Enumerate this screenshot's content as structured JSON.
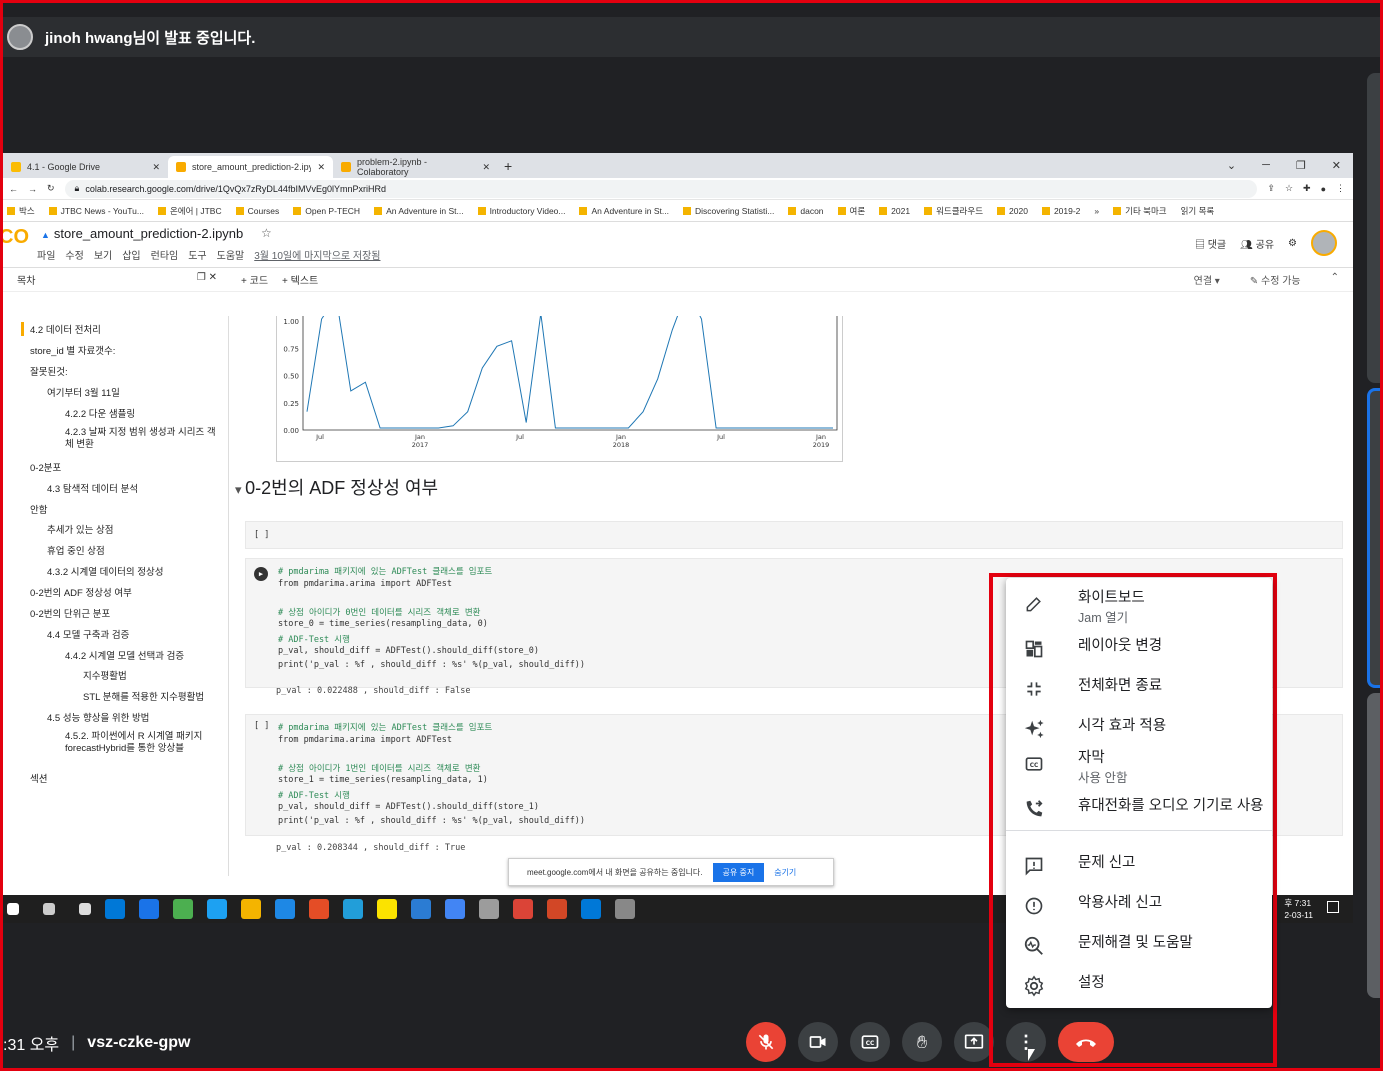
{
  "presenter": {
    "text": "jinoh hwang님이 발표 중입니다."
  },
  "browser": {
    "tabs": [
      {
        "label": "4.1 - Google Drive",
        "favicon_color": "#fbbc04"
      },
      {
        "label": "store_amount_prediction-2.ipyn",
        "favicon_color": "#f9ab00"
      },
      {
        "label": "problem-2.ipynb - Colaboratory",
        "favicon_color": "#f9ab00"
      }
    ],
    "new_tab": "+",
    "url": "colab.research.google.com/drive/1QvQx7zRyDL44fbIMVvEg0lYmnPxriHRd",
    "bookmarks": [
      "박스",
      "JTBC News - YouTu...",
      "온에어 | JTBC",
      "Courses",
      "Open P-TECH",
      "An Adventure in St...",
      "Introductory Video...",
      "An Adventure in St...",
      "Discovering Statisti...",
      "dacon",
      "여론",
      "2021",
      "워드클라우드",
      "2020",
      "2019-2"
    ],
    "bookmarks_more": "»",
    "bookmarks_other": "기타 북마크",
    "reading_list": "읽기 목록"
  },
  "colab": {
    "title": "store_amount_prediction-2.ipynb",
    "menus": [
      "파일",
      "수정",
      "보기",
      "삽입",
      "런타임",
      "도구",
      "도움말"
    ],
    "saved_text": "3월 10일에 마지막으로 저장됨",
    "comment_label": "댓글",
    "share_label": "공유",
    "toc_label": "목차",
    "add_code": "+ 코드",
    "add_text": "+ 텍스트",
    "connect": "연결",
    "editable": "수정 가능",
    "toc": [
      "4.2 데이터 전처리",
      "store_id 별 자료갯수:",
      "잘못된것:",
      "여기부터 3월 11일",
      "4.2.2 다운 샘플링",
      "4.2.3 날짜 지정 범위 생성과 시리즈 객체 변환",
      "0-2분포",
      "4.3 탐색적 데이터 분석",
      "안함",
      "추세가 있는 상점",
      "휴업 중인 상점",
      "4.3.2 시계열 데이터의 정상성",
      "0-2번의 ADF 정상성 여부",
      "0-2번의 단위근 분포",
      "4.4 모델 구축과 검증",
      "4.4.2 시계열 모델 선택과 검증",
      "지수평활법",
      "STL 분해를 적용한 지수평활법",
      "4.5 성능 향상을 위한 방법",
      "4.5.2. 파이썬에서 R 시계열 패키지 forecastHybrid를 통한 앙상블",
      "섹션"
    ],
    "section_heading": "0-2번의 ADF 정상성 여부",
    "empty_cell": "[ ]",
    "cell1": [
      "# pmdarima 패키지에 있는 ADFTest 클래스를 임포트",
      "from pmdarima.arima import ADFTest",
      "",
      "# 상점 아이디가 0번인 데이터를 시리즈 객체로 변환",
      "store_0 = time_series(resampling_data, 0)",
      "# ADF-Test 시행",
      "p_val, should_diff = ADFTest().should_diff(store_0)",
      "print('p_val : %f , should_diff : %s' %(p_val, should_diff))"
    ],
    "cell1_output": "p_val : 0.022488 , should_diff : False",
    "cell2": [
      "# pmdarima 패키지에 있는 ADFTest 클래스를 임포트",
      "from pmdarima.arima import ADFTest",
      "",
      "# 상점 아이디가 1번인 데이터를 시리즈 객체로 변환",
      "store_1 = time_series(resampling_data, 1)",
      "# ADF-Test 시행",
      "p_val, should_diff = ADFTest().should_diff(store_1)",
      "print('p_val : %f , should_diff : %s' %(p_val, should_diff))"
    ],
    "cell2_output": "p_val : 0.208344 , should_diff : True"
  },
  "chart_data": {
    "type": "line",
    "y_ticks": [
      "1.00",
      "0.75",
      "0.50",
      "0.25",
      "0.00"
    ],
    "ylim": [
      0,
      1
    ],
    "x_ticks": [
      "Jul",
      "Jan\n2017",
      "Jul",
      "Jan\n2018",
      "Jul",
      "Jan\n2019"
    ],
    "series": [
      {
        "values": [
          0.15,
          1.0,
          1.2,
          0.34,
          0.42,
          0.0,
          0.0,
          0.0,
          0.0,
          0.0,
          0.02,
          0.15,
          0.55,
          0.75,
          0.8,
          0.05,
          1.05,
          0.0,
          0.0,
          0.0,
          0.0,
          0.0,
          0.0,
          0.15,
          0.45,
          0.9,
          1.35,
          1.0,
          0.0,
          0.0,
          0.0,
          0.0,
          0.0,
          0.0,
          0.0,
          0.0,
          0.0
        ]
      }
    ],
    "color": "#1f77b4"
  },
  "share_notice": {
    "text": "meet.google.com에서 내 화면을 공유하는 중입니다.",
    "stop": "공유 중지",
    "hide": "숨기기"
  },
  "taskbar": {
    "time": "후 7:31",
    "date": "2-03-11"
  },
  "meeting": {
    "time": ":31 오후",
    "separator": "|",
    "code": "vsz-czke-gpw"
  },
  "menu": {
    "items": [
      {
        "label": "화이트보드",
        "sub": "Jam 열기",
        "icon": "pencil-icon"
      },
      {
        "label": "레이아웃 변경",
        "icon": "layout-icon"
      },
      {
        "label": "전체화면 종료",
        "icon": "exit-fullscreen-icon"
      },
      {
        "label": "시각 효과 적용",
        "icon": "sparkle-icon"
      },
      {
        "label": "자막",
        "sub": "사용 안함",
        "icon": "captions-icon"
      },
      {
        "label": "휴대전화를 오디오 기기로 사용",
        "icon": "phone-forward-icon"
      },
      {
        "label": "문제 신고",
        "icon": "feedback-icon"
      },
      {
        "label": "악용사례 신고",
        "icon": "report-icon"
      },
      {
        "label": "문제해결 및 도움말",
        "icon": "troubleshoot-icon"
      },
      {
        "label": "설정",
        "icon": "settings-icon"
      }
    ]
  },
  "colors": {
    "accent_red": "#ea4335",
    "frame_red": "#e3000f",
    "meet_bg": "#202124"
  }
}
